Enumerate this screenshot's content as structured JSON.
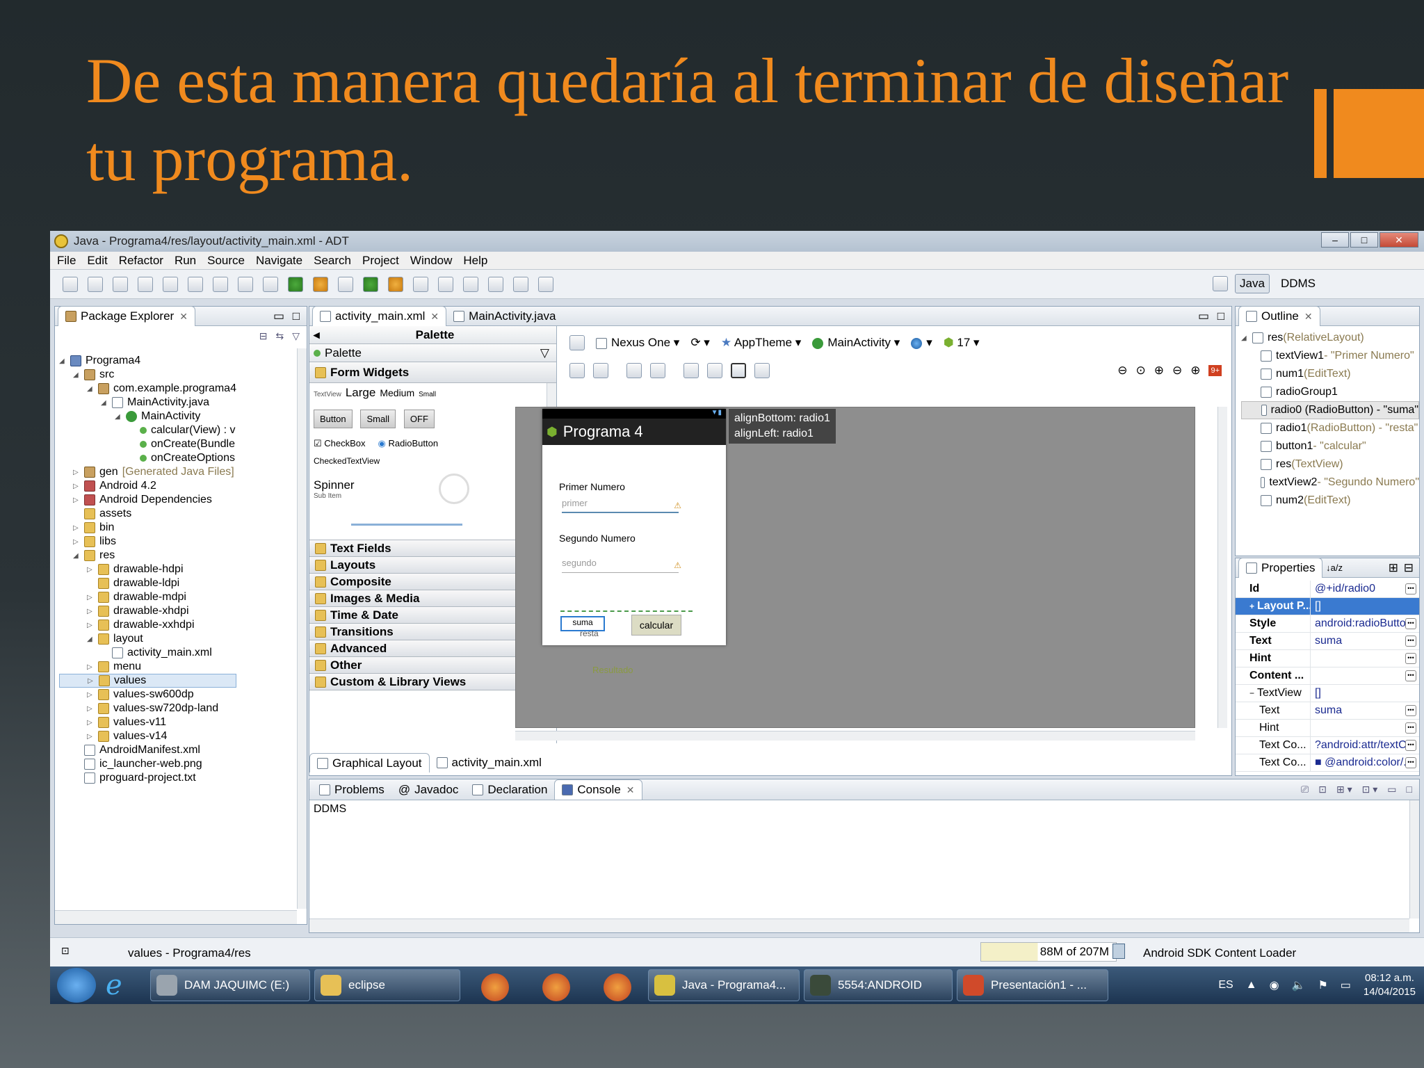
{
  "slide": {
    "title_line1": "De esta manera quedaría al terminar de diseñar",
    "title_line2": "tu programa."
  },
  "window": {
    "title": "Java - Programa4/res/layout/activity_main.xml - ADT",
    "controls": {
      "minimize": "–",
      "maximize": "□",
      "close": "✕"
    }
  },
  "menu": [
    "File",
    "Edit",
    "Refactor",
    "Run",
    "Source",
    "Navigate",
    "Search",
    "Project",
    "Window",
    "Help"
  ],
  "perspectives": {
    "java": "Java",
    "ddms": "DDMS"
  },
  "package_explorer": {
    "tab": "Package Explorer",
    "tree": [
      {
        "label": "Programa4",
        "depth": 0,
        "arrow": "◢",
        "icon": "proj"
      },
      {
        "label": "src",
        "depth": 1,
        "arrow": "◢",
        "icon": "pkg"
      },
      {
        "label": "com.example.programa4",
        "depth": 2,
        "arrow": "◢",
        "icon": "pkg"
      },
      {
        "label": "MainActivity.java",
        "depth": 3,
        "arrow": "◢",
        "icon": "file"
      },
      {
        "label": "MainActivity",
        "depth": 4,
        "arrow": "◢",
        "icon": "class"
      },
      {
        "label": "calcular(View) : v",
        "depth": 5,
        "arrow": "",
        "icon": "method"
      },
      {
        "label": "onCreate(Bundle",
        "depth": 5,
        "arrow": "",
        "icon": "method"
      },
      {
        "label": "onCreateOptions",
        "depth": 5,
        "arrow": "",
        "icon": "method"
      },
      {
        "label": "gen",
        "extra": "[Generated Java Files]",
        "depth": 1,
        "arrow": "▷",
        "icon": "pkg"
      },
      {
        "label": "Android 4.2",
        "depth": 1,
        "arrow": "▷",
        "icon": "lib"
      },
      {
        "label": "Android Dependencies",
        "depth": 1,
        "arrow": "▷",
        "icon": "lib"
      },
      {
        "label": "assets",
        "depth": 1,
        "arrow": "",
        "icon": "folder"
      },
      {
        "label": "bin",
        "depth": 1,
        "arrow": "▷",
        "icon": "folder"
      },
      {
        "label": "libs",
        "depth": 1,
        "arrow": "▷",
        "icon": "folder"
      },
      {
        "label": "res",
        "depth": 1,
        "arrow": "◢",
        "icon": "folder"
      },
      {
        "label": "drawable-hdpi",
        "depth": 2,
        "arrow": "▷",
        "icon": "folder"
      },
      {
        "label": "drawable-ldpi",
        "depth": 2,
        "arrow": "",
        "icon": "folder"
      },
      {
        "label": "drawable-mdpi",
        "depth": 2,
        "arrow": "▷",
        "icon": "folder"
      },
      {
        "label": "drawable-xhdpi",
        "depth": 2,
        "arrow": "▷",
        "icon": "folder"
      },
      {
        "label": "drawable-xxhdpi",
        "depth": 2,
        "arrow": "▷",
        "icon": "folder"
      },
      {
        "label": "layout",
        "depth": 2,
        "arrow": "◢",
        "icon": "folder"
      },
      {
        "label": "activity_main.xml",
        "depth": 3,
        "arrow": "",
        "icon": "file"
      },
      {
        "label": "menu",
        "depth": 2,
        "arrow": "▷",
        "icon": "folder"
      },
      {
        "label": "values",
        "depth": 2,
        "arrow": "▷",
        "icon": "folder",
        "selected": true
      },
      {
        "label": "values-sw600dp",
        "depth": 2,
        "arrow": "▷",
        "icon": "folder"
      },
      {
        "label": "values-sw720dp-land",
        "depth": 2,
        "arrow": "▷",
        "icon": "folder"
      },
      {
        "label": "values-v11",
        "depth": 2,
        "arrow": "▷",
        "icon": "folder"
      },
      {
        "label": "values-v14",
        "depth": 2,
        "arrow": "▷",
        "icon": "folder"
      },
      {
        "label": "AndroidManifest.xml",
        "depth": 1,
        "arrow": "",
        "icon": "file"
      },
      {
        "label": "ic_launcher-web.png",
        "depth": 1,
        "arrow": "",
        "icon": "file"
      },
      {
        "label": "proguard-project.txt",
        "depth": 1,
        "arrow": "",
        "icon": "file"
      }
    ]
  },
  "editor": {
    "tabs": [
      "activity_main.xml",
      "MainActivity.java"
    ],
    "palette_header": "Palette",
    "palette_dropdown": "Palette",
    "form_widgets": "Form Widgets",
    "textview_sizes": {
      "label": "TextView",
      "large": "Large",
      "medium": "Medium",
      "small": "Small"
    },
    "widgets": {
      "button": "Button",
      "small": "Small",
      "off": "OFF",
      "checkbox": "CheckBox",
      "radiobutton": "RadioButton",
      "checkedtextview": "CheckedTextView",
      "spinner": "Spinner",
      "sub_item": "Sub Item"
    },
    "categories": [
      "Text Fields",
      "Layouts",
      "Composite",
      "Images & Media",
      "Time & Date",
      "Transitions",
      "Advanced",
      "Other",
      "Custom & Library Views"
    ],
    "config": {
      "device": "Nexus One",
      "theme": "AppTheme",
      "activity": "MainActivity",
      "api": "17"
    },
    "bottom_tabs": [
      "Graphical Layout",
      "activity_main.xml"
    ],
    "tooltip": [
      "alignBottom: radio1",
      "alignLeft: radio1"
    ],
    "phone": {
      "app_title": "Programa  4",
      "label1": "Primer Numero",
      "hint1": "primer",
      "label2": "Segundo Numero",
      "hint2": "segundo",
      "radio_suma": "suma",
      "radio_resta": "resta",
      "button": "calcular",
      "result": "Resultado"
    }
  },
  "outline": {
    "tab": "Outline",
    "rows": [
      {
        "name": "res",
        "detail": "(RelativeLayout)",
        "depth": 0
      },
      {
        "name": "textView1",
        "detail": " - \"Primer Numero\"",
        "depth": 1
      },
      {
        "name": "num1",
        "detail": " (EditText)",
        "depth": 1
      },
      {
        "name": "radioGroup1",
        "detail": "",
        "depth": 1
      },
      {
        "name": "radio0 (RadioButton) - \"suma\"",
        "detail": "",
        "depth": 1,
        "selected": true
      },
      {
        "name": "radio1",
        "detail": " (RadioButton) - \"resta\"",
        "depth": 1
      },
      {
        "name": "button1",
        "detail": " - \"calcular\"",
        "depth": 1
      },
      {
        "name": "res",
        "detail": "  (TextView)",
        "depth": 1
      },
      {
        "name": "textView2",
        "detail": " - \"Segundo Numero\"",
        "depth": 1
      },
      {
        "name": "num2",
        "detail": " (EditText)",
        "depth": 1
      }
    ]
  },
  "properties": {
    "tab": "Properties",
    "rows": [
      {
        "key": "Id",
        "value": "@+id/radio0",
        "btn": true
      },
      {
        "key": "Layout P...",
        "value": "[]",
        "btn": false,
        "highlight": true,
        "expander": "+"
      },
      {
        "key": "Style",
        "value": "android:radioButto...",
        "btn": true
      },
      {
        "key": "Text",
        "value": "suma",
        "btn": true
      },
      {
        "key": "Hint",
        "value": "",
        "btn": true
      },
      {
        "key": "Content ...",
        "value": "",
        "btn": true
      },
      {
        "key": "TextView",
        "value": "[]",
        "btn": false,
        "plain": true,
        "expander": "−"
      },
      {
        "key": "Text",
        "value": "suma",
        "btn": true,
        "indent": true
      },
      {
        "key": "Hint",
        "value": "",
        "btn": true,
        "indent": true
      },
      {
        "key": "Text Co...",
        "value": "?android:attr/textC...",
        "btn": true,
        "indent": true
      },
      {
        "key": "Text Co...",
        "value": "■ @android:color/...",
        "btn": true,
        "indent": true
      }
    ]
  },
  "console": {
    "tabs": [
      "Problems",
      "Javadoc",
      "Declaration",
      "Console"
    ],
    "content": "DDMS"
  },
  "status": {
    "path": "values - Programa4/res",
    "memory": "88M of 207M",
    "loader": "Android SDK Content Loader"
  },
  "taskbar": {
    "items": [
      {
        "label": "DAM JAQUIMC (E:)",
        "color": "#9aa4ae"
      },
      {
        "label": "eclipse",
        "color": "#e7c056"
      },
      {
        "label": "Java - Programa4...",
        "color": "#d8c040"
      },
      {
        "label": "5554:ANDROID",
        "color": "#3a4a3a"
      },
      {
        "label": "Presentación1 - ...",
        "color": "#d04a2a"
      }
    ],
    "lang": "ES",
    "time": "08:12 a.m.",
    "date": "14/04/2015"
  }
}
